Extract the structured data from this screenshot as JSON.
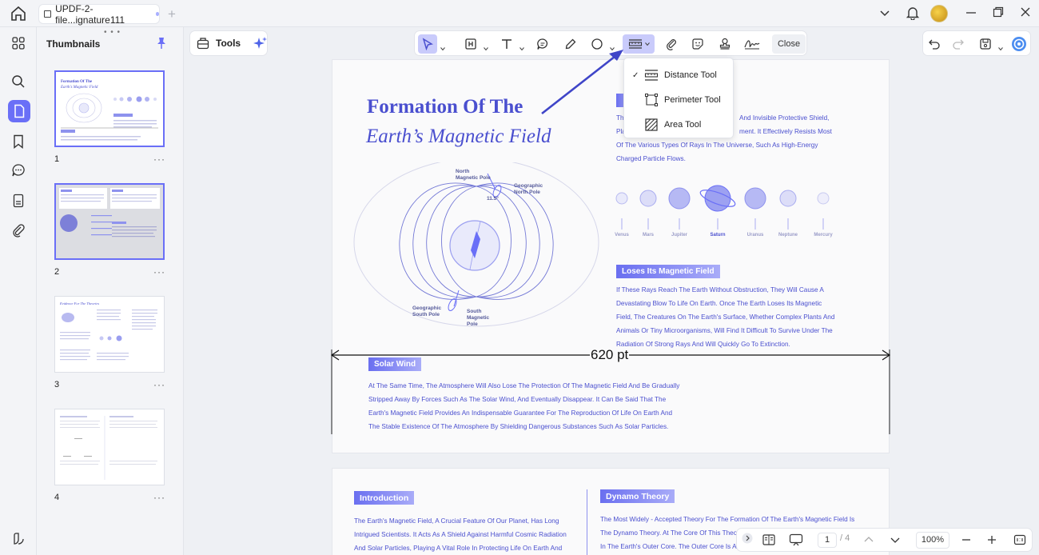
{
  "window": {
    "tab_title": "UPDF-2-file...ignature111",
    "tab_add": "+"
  },
  "thumbnails": {
    "panel_title": "Thumbnails",
    "grip": "• • •",
    "more": "···",
    "pages": [
      {
        "number": "1"
      },
      {
        "number": "2"
      },
      {
        "number": "3"
      },
      {
        "number": "4"
      }
    ]
  },
  "toolbar": {
    "tools_label": "Tools",
    "close_label": "Close"
  },
  "dropdown": {
    "check": "✓",
    "items": [
      {
        "label": "Distance Tool",
        "checked": true
      },
      {
        "label": "Perimeter Tool",
        "checked": false
      },
      {
        "label": "Area Tool",
        "checked": false
      }
    ]
  },
  "document": {
    "title_line1": "Formation Of The",
    "title_line2": "Earth’s Magnetic Field",
    "hidden_para": [
      "Th",
      "Pla",
      "Of The Various Types Of Rays In The Universe, Such As High-Energy",
      "Charged Particle Flows."
    ],
    "hidden_para_tail": [
      "And Invisible Protective Shield,",
      "ment. It Effectively Resists Most"
    ],
    "diagram_labels": {
      "north_magnetic": "North\nMagnetic Pole",
      "geo_north": "Geographic\nNorth Pole",
      "angle": "11.5°",
      "geo_south": "Geographic\nSouth Pole",
      "south_magnetic": "South\nMagnetic\nPole"
    },
    "planets": [
      "Venus",
      "Mars",
      "Jupiter",
      "Saturn",
      "Uranus",
      "Neptune",
      "Mercury"
    ],
    "section_loses": "Loses Its Magnetic Field",
    "loses_para": [
      "If These Rays Reach The Earth Without Obstruction, They Will Cause A",
      "Devastating Blow To Life On Earth. Once The Earth Loses Its Magnetic",
      "Field, The Creatures On The Earth's Surface, Whether Complex Plants And",
      "Animals Or Tiny Microorganisms, Will Find It Difficult To Survive Under The",
      "Radiation Of Strong Rays And Will Quickly Go To Extinction."
    ],
    "section_solar": "Solar Wind",
    "solar_para": [
      "At The Same Time, The Atmosphere Will Also Lose The Protection Of The Magnetic Field And Be Gradually",
      "Stripped Away By Forces Such As The Solar Wind, And Eventually Disappear. It Can Be Said That The",
      "Earth's Magnetic Field Provides An Indispensable Guarantee For The Reproduction Of Life On Earth And",
      "The Stable Existence Of The Atmosphere By Shielding Dangerous Substances Such As Solar Particles."
    ],
    "measurement": "620 pt",
    "page2": {
      "intro_title": "Introduction",
      "intro_para": [
        "The Earth's Magnetic Field, A Crucial Feature Of Our Planet, Has Long",
        "Intrigued Scientists. It Acts As A Shield Against Harmful Cosmic Radiation",
        "And Solar Particles, Playing A Vital Role In Protecting Life On Earth And"
      ],
      "dynamo_title": "Dynamo Theory",
      "dynamo_para": [
        "The Most Widely - Accepted Theory For The Formation Of The Earth's Magnetic Field Is",
        "The Dynamo Theory. At The Core Of This Theor",
        "In The Earth's Outer Core. The Outer Core Is A"
      ]
    }
  },
  "navigation": {
    "current_page": "1",
    "total_pages": "/ 4",
    "zoom": "100%"
  },
  "colors": {
    "accent": "#6a6ff7",
    "doc_text": "#4a4fcf",
    "measure_line": "#111111",
    "arrow": "#3f45c8"
  }
}
